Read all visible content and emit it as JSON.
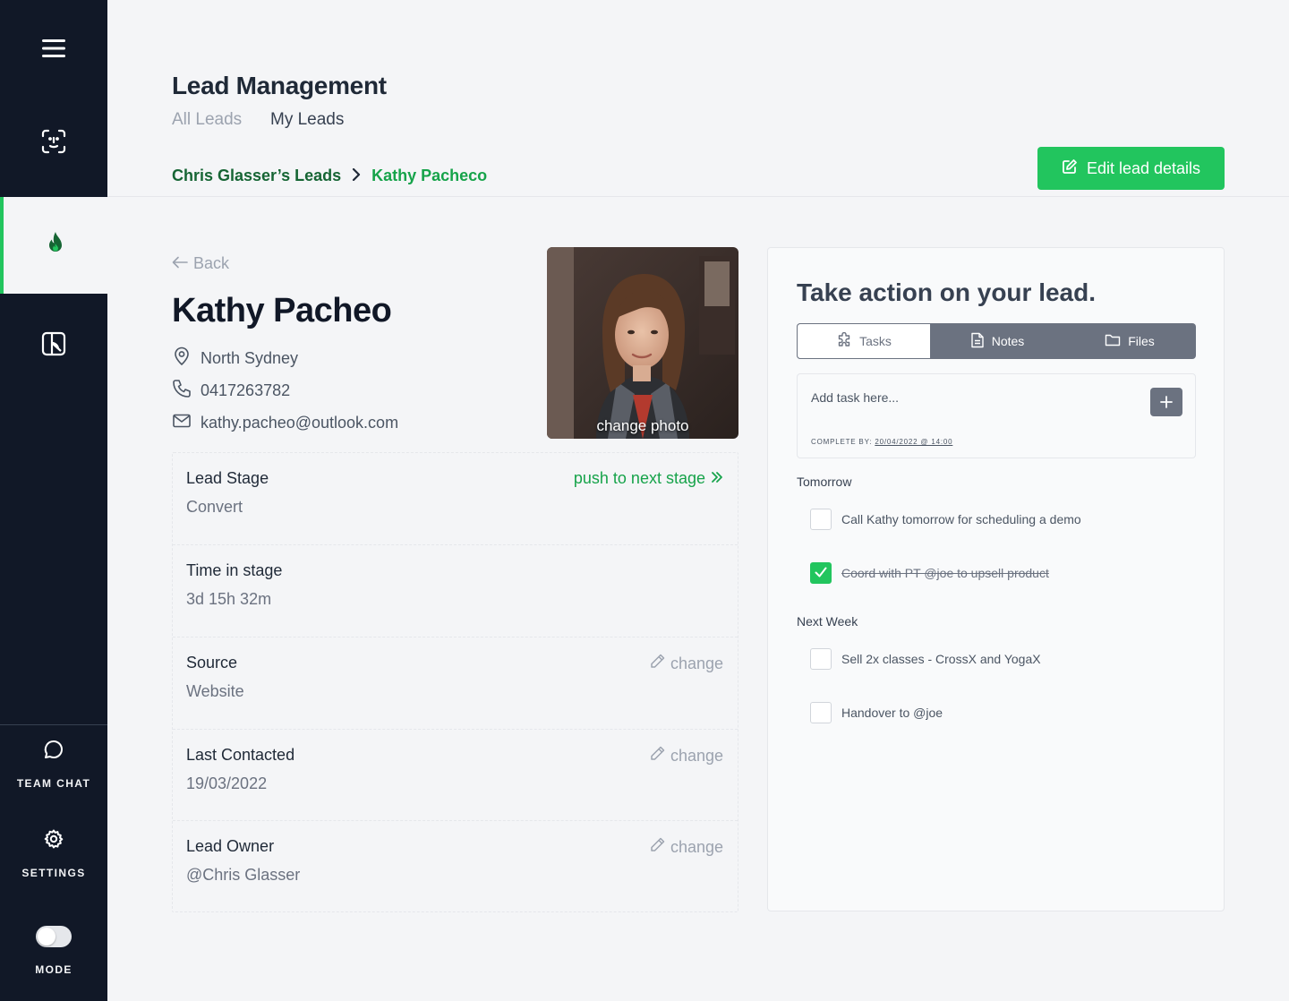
{
  "sidebar": {
    "team_chat": "TEAM CHAT",
    "settings": "SETTINGS",
    "mode": "MODE",
    "mode_dark": false
  },
  "header": {
    "title": "Lead Management",
    "tabs": [
      {
        "label": "All Leads",
        "active": false
      },
      {
        "label": "My Leads",
        "active": true
      }
    ],
    "breadcrumb": [
      "Chris Glasser’s Leads",
      "Kathy Pacheco"
    ],
    "edit_button": "Edit lead details"
  },
  "lead": {
    "back": "Back",
    "name": "Kathy Pacheo",
    "location": "North Sydney",
    "phone": "0417263782",
    "email": "kathy.pacheo@outlook.com",
    "photo_label": "change photo"
  },
  "info": {
    "stage_label": "Lead Stage",
    "stage_value": "Convert",
    "stage_action": "push to next stage",
    "time_label": "Time in stage",
    "time_value": "3d 15h 32m",
    "source_label": "Source",
    "source_value": "Website",
    "source_action": "change",
    "contacted_label": "Last Contacted",
    "contacted_value": "19/03/2022",
    "contacted_action": "change",
    "owner_label": "Lead Owner",
    "owner_value": "@Chris Glasser",
    "owner_action": "change"
  },
  "actions": {
    "title": "Take action on your lead.",
    "tabs": {
      "tasks": "Tasks",
      "notes": "Notes",
      "files": "Files"
    },
    "active_tab": "Tasks",
    "task_placeholder": "Add task here...",
    "complete_by_label": "COMPLETE BY:",
    "complete_by_date": "20/04/2022 @ 14:00",
    "groups": [
      {
        "heading": "Tomorrow",
        "tasks": [
          {
            "text": "Call Kathy tomorrow for scheduling a demo",
            "done": false
          },
          {
            "text": "Coord with PT @joe to upsell product",
            "done": true
          }
        ]
      },
      {
        "heading": "Next Week",
        "tasks": [
          {
            "text": "Sell 2x classes - CrossX and YogaX",
            "done": false
          },
          {
            "text": "Handover to @joe",
            "done": false
          }
        ]
      }
    ]
  },
  "colors": {
    "sidebar_bg": "#111827",
    "accent": "#22c55e",
    "accent_dark": "#166534",
    "page_bg": "#f4f5f7",
    "segment_bg": "#6b7280"
  }
}
